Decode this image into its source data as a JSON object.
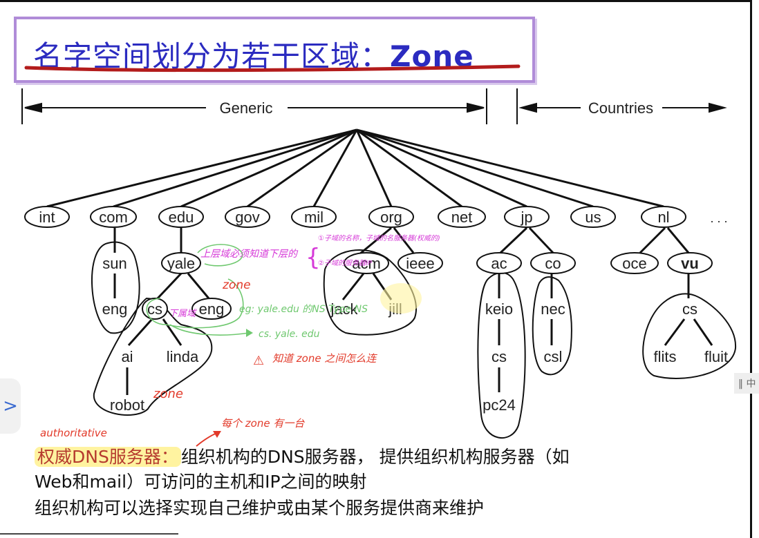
{
  "title": {
    "cn": "名字空间划分为若干区域：",
    "latin": "Zone"
  },
  "ranges": {
    "generic": "Generic",
    "countries": "Countries"
  },
  "tld": {
    "int": "int",
    "com": "com",
    "edu": "edu",
    "gov": "gov",
    "mil": "mil",
    "org": "org",
    "net": "net",
    "jp": "jp",
    "us": "us",
    "nl": "nl",
    "more": ". . ."
  },
  "nodes": {
    "sun": "sun",
    "eng_com": "eng",
    "yale": "yale",
    "cs_yale": "cs",
    "eng_yale": "eng",
    "ai": "ai",
    "linda": "linda",
    "robot": "robot",
    "acm": "acm",
    "ieee": "ieee",
    "jack": "jack",
    "jill": "jill",
    "ac": "ac",
    "co": "co",
    "keio": "keio",
    "cs_keio": "cs",
    "pc24": "pc24",
    "nec": "nec",
    "csl": "csl",
    "oce": "oce",
    "vu": "vu",
    "cs_vu": "cs",
    "flits": "flits",
    "fluit": "fluit"
  },
  "annotations": {
    "upper_domain": "上层域必须知道下层的",
    "note1": "①子域的名称，子域的名服务器(权威的)",
    "note2": "②子域的服务器IP",
    "zone_top": "zone",
    "example": "eg: yale.edu 的NS Type NS",
    "cs_domain": "下属域",
    "cs_link": "cs. yale. edu",
    "warning": "知道 zone 之间怎么连",
    "zone_bottom": "zone",
    "authoritative": "authoritative",
    "each_zone": "每个 zone 有一台"
  },
  "body": {
    "line1_highlight": "权威DNS服务器：",
    "line1_rest": "组织机构的DNS服务器， 提供组织机构服务器（如",
    "line2": "Web和mail）可访问的主机和IP之间的映射",
    "line3": "组织机构可以选择实现自己维护或由某个服务提供商来维护"
  },
  "ui": {
    "side_arrow": ">",
    "right_tab": "‖ 中"
  },
  "colors": {
    "title": "#2b2bc0",
    "frame": "#b08cd8",
    "annotation": "#d63ad8",
    "annotation_green": "#6fc86f",
    "annotation_red": "#e23a2a",
    "highlight": "#fff3a0"
  }
}
